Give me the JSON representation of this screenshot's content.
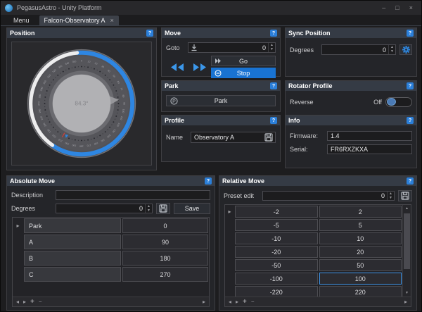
{
  "ui": {
    "help_glyph": "?",
    "spin_up": "▲",
    "spin_down": "▼",
    "row_marker": "▸",
    "nav_first": "◂",
    "nav_prev": "▸",
    "nav_add": "+",
    "nav_remove": "−",
    "nav_end": "▸",
    "scroll_up": "▲",
    "scroll_down": "▼"
  },
  "colors": {
    "accent": "#2e86e2",
    "stop_button": "#1973d2",
    "panel_header": "#353b45",
    "arc_white": "#ededee",
    "dial_center": "#b1b1b4"
  },
  "titlebar": {
    "title": "PegasusAstro - Unity Platform",
    "minimize": "–",
    "maximize": "□",
    "close": "×"
  },
  "tabs": {
    "menu_label": "Menu",
    "active_tab": "Falcon-Observatory A",
    "close_glyph": "×"
  },
  "position": {
    "title": "Position",
    "dial": {
      "value_label": "84.3°",
      "value_deg": 84.3,
      "tick_step": 10
    }
  },
  "move": {
    "title": "Move",
    "goto_label": "Goto",
    "goto_value": "0",
    "go_label": "Go",
    "stop_label": "Stop"
  },
  "sync_position": {
    "title": "Sync Position",
    "degrees_label": "Degrees",
    "degrees_value": "0"
  },
  "park": {
    "title": "Park",
    "button_label": "Park"
  },
  "rotator_profile": {
    "title": "Rotator Profile",
    "reverse_label": "Reverse",
    "toggle_state": "Off"
  },
  "profile": {
    "title": "Profile",
    "name_label": "Name",
    "name_value": "Observatory A"
  },
  "info": {
    "title": "Info",
    "firmware_label": "Firmware:",
    "firmware_value": "1.4",
    "serial_label": "Serial:",
    "serial_value": "FR6RXZKXA"
  },
  "absolute_move": {
    "title": "Absolute Move",
    "description_label": "Description",
    "description_value": "",
    "degrees_label": "Degrees",
    "degrees_value": "0",
    "save_label": "Save",
    "rows": [
      {
        "name": "Park",
        "value": "0"
      },
      {
        "name": "A",
        "value": "90"
      },
      {
        "name": "B",
        "value": "180"
      },
      {
        "name": "C",
        "value": "270"
      }
    ]
  },
  "relative_move": {
    "title": "Relative Move",
    "preset_label": "Preset edit",
    "preset_value": "0",
    "rows": [
      {
        "neg": "-2",
        "pos": "2"
      },
      {
        "neg": "-5",
        "pos": "5"
      },
      {
        "neg": "-10",
        "pos": "10"
      },
      {
        "neg": "-20",
        "pos": "20"
      },
      {
        "neg": "-50",
        "pos": "50"
      },
      {
        "neg": "-100",
        "pos": "100"
      },
      {
        "neg": "-220",
        "pos": "220"
      }
    ],
    "selected_value": "100"
  }
}
